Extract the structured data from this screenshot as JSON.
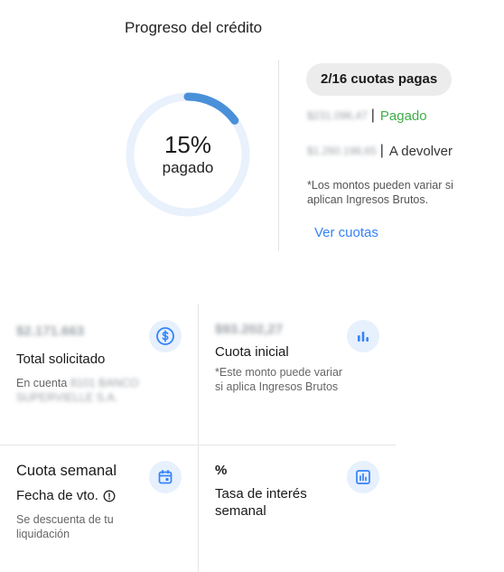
{
  "progress": {
    "title": "Progreso del crédito",
    "percent_label": "15%",
    "percent_value": 15,
    "percent_caption": "pagado",
    "installments_chip": "2/16 cuotas pagas",
    "paid_amount": "$231.096,47",
    "paid_label": "Pagado",
    "return_amount": "$1.260.198,65",
    "return_label": "A devolver",
    "disclaimer": "*Los montos pueden variar si aplican Ingresos Brutos.",
    "see_installments": "Ver cuotas"
  },
  "cards": {
    "total": {
      "amount": "$2.171.663",
      "title": "Total solicitado",
      "account_prefix": "En cuenta",
      "account_name": "8101 BANCO SUPERVIELLE S.A.",
      "icon": "dollar-circle-icon"
    },
    "initial": {
      "amount": "$93.202,27",
      "title": "Cuota inicial",
      "note": "*Este monto puede variar si aplica Ingresos Brutos",
      "icon": "bar-chart-icon"
    },
    "weekly": {
      "title": "Cuota semanal",
      "due_label": "Fecha de vto.",
      "note": "Se descuenta de tu liquidación",
      "icon": "calendar-icon"
    },
    "rate": {
      "value": "%",
      "title": "Tasa de interés semanal",
      "icon": "chart-box-icon"
    }
  },
  "colors": {
    "accent": "#3483fa",
    "progress_fill": "#4a90d9",
    "progress_track": "#e8f1fc",
    "paid_green": "#3fae49",
    "icon_bg": "#e7f0fd"
  }
}
